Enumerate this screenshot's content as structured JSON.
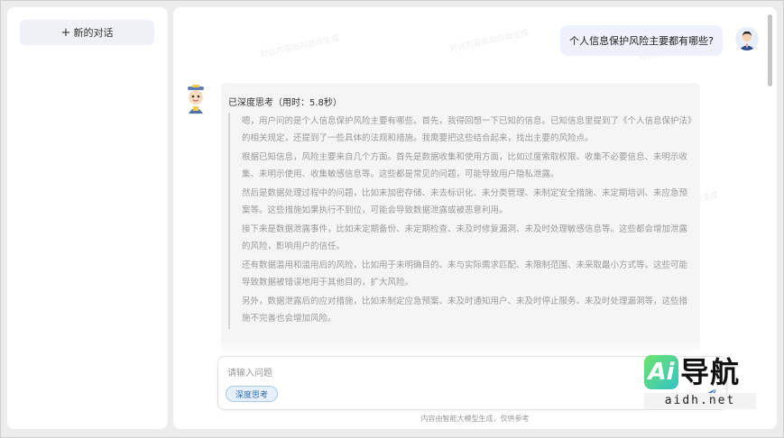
{
  "sidebar": {
    "new_chat_label": "新的对话"
  },
  "watermark_text": "对话内容由AI自动生成",
  "conversation": {
    "user_message": "个人信息保护风险主要都有哪些?",
    "think_title": "已深度思考（用时：5.8秒）",
    "think_paragraphs": [
      "嗯，用户问的是个人信息保护风险主要有哪些。首先，我得回想一下已知的信息。已知信息里提到了《个人信息保护法》的相关规定，还提到了一些具体的法规和措施。我需要把这些结合起来，找出主要的风险点。",
      "根据已知信息，风险主要来自几个方面。首先是数据收集和使用方面，比如过度索取权限、收集不必要信息、未明示收集、未明示使用、收集敏感信息等。这些都是常见的问题，可能导致用户隐私泄露。",
      "然后是数据处理过程中的问题，比如未加密存储、未去标识化、未分类管理、未制定安全措施、未定期培训、未应急预案等。这些措施如果执行不到位，可能会导致数据泄露或被恶意利用。",
      "接下来是数据泄露事件，比如未定期备份、未定期检查、未及时修复漏洞、未及时处理敏感信息等。这些都会增加泄露的风险，影响用户的信任。",
      "还有数据滥用和滥用后的风险，比如用于未明确目的、未与实际需求匹配、未限制范围、未采取最小方式等。这些可能导致数据被错误地用于其他目的，扩大风险。",
      "另外，数据泄露后的应对措施，比如未制定应急预案、未及时通知用户、未及时停止服务、未及时处理漏洞等，这些措施不完善也会增加风险。"
    ]
  },
  "input": {
    "placeholder": "请输入问题",
    "deep_think_label": "深度思考"
  },
  "disclaimer": "内容由智能大模型生成，仅供参考",
  "brand": {
    "badge": "Ai",
    "name": "导航",
    "url": "aidh.net"
  },
  "colors": {
    "accent": "#2f6db5",
    "user_bubble": "#eef1fb",
    "answer_bg": "#f5f5f5"
  }
}
